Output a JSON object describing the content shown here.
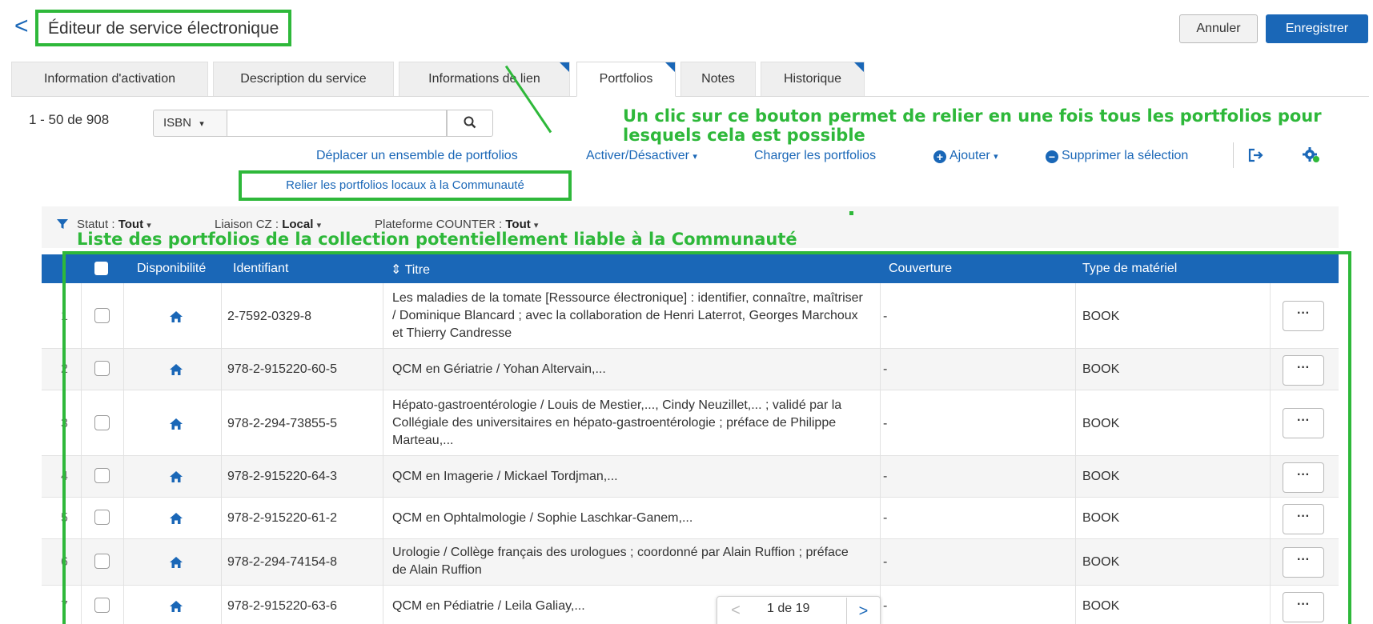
{
  "header": {
    "title": "Éditeur de service électronique",
    "cancel_label": "Annuler",
    "save_label": "Enregistrer"
  },
  "tabs": [
    {
      "label": "Information d'activation"
    },
    {
      "label": "Description du service"
    },
    {
      "label": "Informations de lien"
    },
    {
      "label": "Portfolios"
    },
    {
      "label": "Notes"
    },
    {
      "label": "Historique"
    }
  ],
  "toolbar": {
    "count": "1 - 50 de 908",
    "search_field": "ISBN",
    "search_placeholder": "",
    "actions": {
      "move": "Déplacer un ensemble de portfolios",
      "activate": "Activer/Désactiver",
      "load": "Charger les portfolios",
      "add": "Ajouter",
      "delete": "Supprimer la sélection"
    },
    "relier": "Relier les portfolios locaux à la Communauté"
  },
  "annotations": {
    "button_note": "Un clic sur ce bouton permet de relier en une fois tous les portfolios pour lesquels cela est possible",
    "list_note": "Liste des portfolios de la collection potentiellement liable à la Communauté"
  },
  "filters": {
    "status_label": "Statut :",
    "status_value": "Tout",
    "cz_label": "Liaison CZ :",
    "cz_value": "Local",
    "counter_label": "Plateforme COUNTER :",
    "counter_value": "Tout"
  },
  "table": {
    "columns": {
      "availability": "Disponibilité",
      "identifier": "Identifiant",
      "title": "Titre",
      "coverage": "Couverture",
      "material_type": "Type de matériel"
    },
    "rows": [
      {
        "num": "1",
        "identifier": "2-7592-0329-8",
        "title": "Les maladies de la tomate [Ressource électronique] : identifier, connaître, maîtriser / Dominique Blancard ; avec la collaboration de Henri Laterrot, Georges Marchoux et Thierry Candresse",
        "coverage": "-",
        "type": "BOOK"
      },
      {
        "num": "2",
        "identifier": "978-2-915220-60-5",
        "title": "QCM en Gériatrie / Yohan Altervain,...",
        "coverage": "-",
        "type": "BOOK"
      },
      {
        "num": "3",
        "identifier": "978-2-294-73855-5",
        "title": "Hépato-gastroentérologie / Louis de Mestier,..., Cindy Neuzillet,... ; validé par la Collégiale des universitaires en hépato-gastroentérologie ; préface de Philippe Marteau,...",
        "coverage": "-",
        "type": "BOOK"
      },
      {
        "num": "4",
        "identifier": "978-2-915220-64-3",
        "title": "QCM en Imagerie / Mickael Tordjman,...",
        "coverage": "-",
        "type": "BOOK"
      },
      {
        "num": "5",
        "identifier": "978-2-915220-61-2",
        "title": "QCM en Ophtalmologie / Sophie Laschkar-Ganem,...",
        "coverage": "-",
        "type": "BOOK"
      },
      {
        "num": "6",
        "identifier": "978-2-294-74154-8",
        "title": "Urologie / Collège français des urologues ; coordonné par Alain Ruffion ; préface de Alain Ruffion",
        "coverage": "-",
        "type": "BOOK"
      },
      {
        "num": "7",
        "identifier": "978-2-915220-63-6",
        "title": "QCM en Pédiatrie / Leila Galiay,...",
        "coverage": "-",
        "type": "BOOK"
      }
    ],
    "more_label": "···"
  },
  "pagination": {
    "text": "1 de 19"
  }
}
